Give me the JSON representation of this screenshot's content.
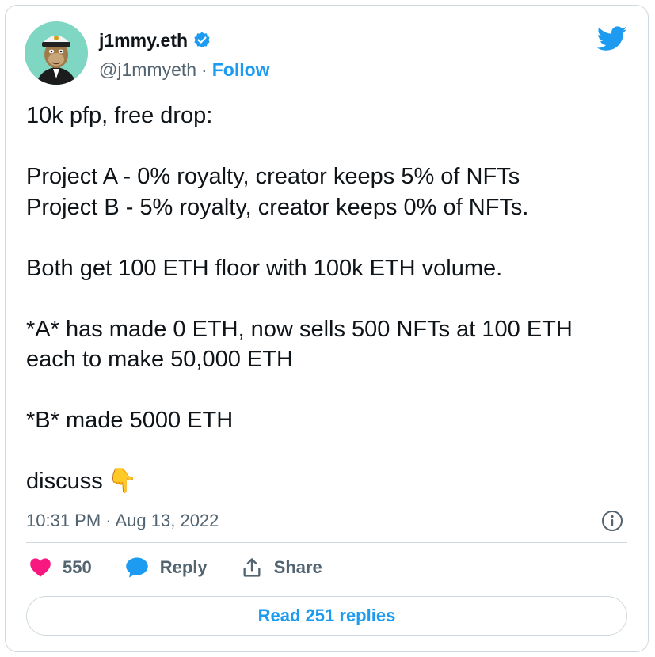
{
  "author": {
    "display_name": "j1mmy.eth",
    "handle": "@j1mmyeth",
    "separator": "·",
    "follow_label": "Follow",
    "verified": true
  },
  "tweet": {
    "line1": "10k pfp, free drop:",
    "line2": "Project A - 0% royalty, creator keeps 5% of NFTs",
    "line3": "Project B - 5% royalty, creator keeps 0% of NFTs.",
    "line4": "Both get 100 ETH floor with 100k ETH volume.",
    "line5": "*A* has made 0 ETH, now sells 500 NFTs at 100 ETH",
    "line6": "each to make 50,000 ETH",
    "line7": "*B* made 5000 ETH",
    "line8": "discuss",
    "emoji": "👇"
  },
  "meta": {
    "timestamp": "10:31 PM · Aug 13, 2022"
  },
  "actions": {
    "like_count": "550",
    "reply_label": "Reply",
    "share_label": "Share"
  },
  "read_replies_label": "Read 251 replies",
  "colors": {
    "accent": "#1d9bf0",
    "like": "#f91880",
    "text": "#0f1419",
    "muted": "#536471",
    "border": "#cfd9de"
  },
  "icons": [
    "verified-badge-icon",
    "twitter-bird-icon",
    "info-icon",
    "heart-icon",
    "reply-bubble-icon",
    "share-icon"
  ]
}
